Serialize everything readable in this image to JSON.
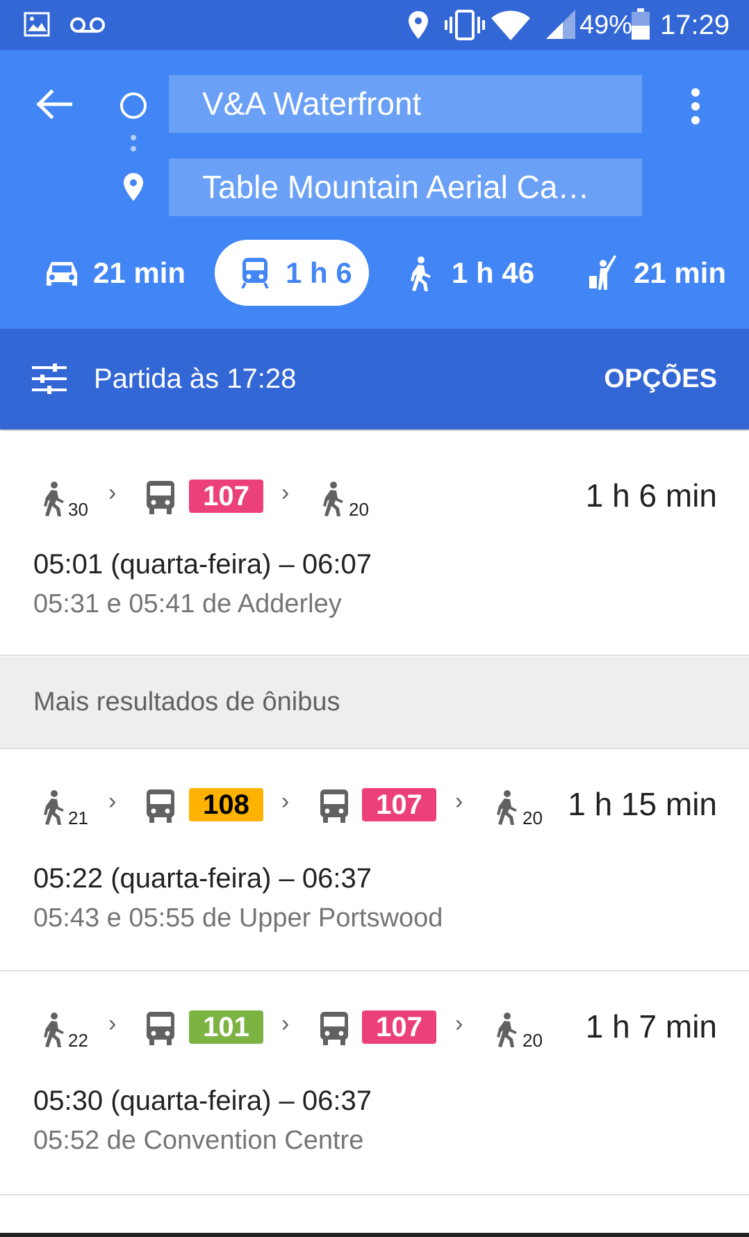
{
  "status_bar": {
    "battery": "49%",
    "time": "17:29"
  },
  "header": {
    "origin": "V&A Waterfront",
    "destination": "Table Mountain Aerial Ca…",
    "modes": [
      {
        "icon": "car-icon",
        "label": "21 min"
      },
      {
        "icon": "transit-icon",
        "label": "1 h 6",
        "selected": true
      },
      {
        "icon": "walk-icon",
        "label": "1 h 46"
      },
      {
        "icon": "ride-icon",
        "label": "21 min"
      }
    ]
  },
  "options_bar": {
    "departure": "Partida às 17:28",
    "options_label": "OPÇÕES"
  },
  "routes": [
    {
      "walk_start": "30",
      "buses": [
        {
          "number": "107",
          "color": "#ec407a",
          "text_color": "#ffffff"
        }
      ],
      "walk_end": "20",
      "duration": "1 h 6 min",
      "times": "05:01 (quarta-feira) – 06:07",
      "stop": "05:31 e 05:41 de Adderley"
    },
    {
      "walk_start": "21",
      "buses": [
        {
          "number": "108",
          "color": "#ffb300",
          "text_color": "#000000"
        },
        {
          "number": "107",
          "color": "#ec407a",
          "text_color": "#ffffff"
        }
      ],
      "walk_end": "20",
      "duration": "1 h 15 min",
      "times": "05:22 (quarta-feira) – 06:37",
      "stop": "05:43 e 05:55 de Upper Portswood"
    },
    {
      "walk_start": "22",
      "buses": [
        {
          "number": "101",
          "color": "#7cb342",
          "text_color": "#ffffff"
        },
        {
          "number": "107",
          "color": "#ec407a",
          "text_color": "#ffffff"
        }
      ],
      "walk_end": "20",
      "duration": "1 h 7 min",
      "times": "05:30 (quarta-feira) – 06:37",
      "stop": "05:52 de Convention Centre"
    }
  ],
  "section_label": "Mais resultados de ônibus",
  "colors": {
    "status_bar": "#3367d6",
    "header": "#4285f4",
    "field": "#6aa0f6",
    "accent": "#4285f4"
  }
}
